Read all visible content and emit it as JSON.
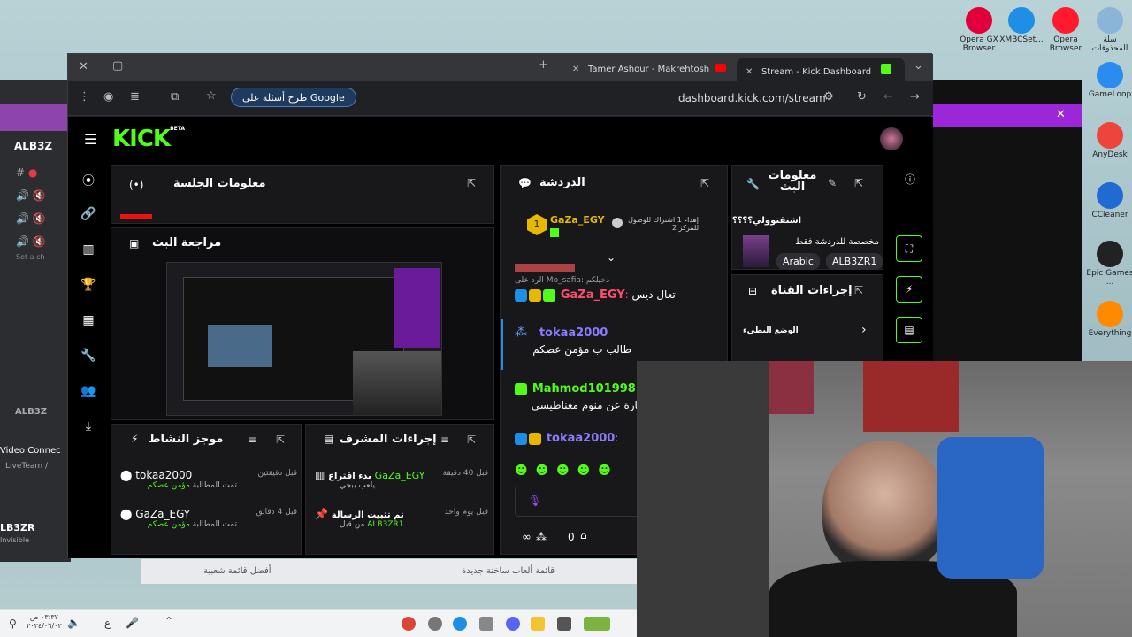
{
  "desktop": {
    "icons": [
      {
        "label": "Opera GX Browser",
        "color": "#e1003c"
      },
      {
        "label": "XMBCSet...",
        "color": "#1f8fe5"
      },
      {
        "label": "Opera Browser",
        "color": "#ff1b2d"
      },
      {
        "label": "سلة المحذوفات",
        "color": "#8ab4d8"
      },
      {
        "label": "GameLoop",
        "color": "#2a8cf0"
      },
      {
        "label": "AnyDesk",
        "color": "#ef443b"
      },
      {
        "label": "CCleaner",
        "color": "#1f6bd1"
      },
      {
        "label": "Epic Games ...",
        "color": "#222222"
      },
      {
        "label": "Everything",
        "color": "#ff8a00"
      }
    ]
  },
  "taskbar": {
    "clock_time": "٠٣:٣٧ ص",
    "clock_date": "٢٠٢٤/٠٦/٠٢",
    "lang": "ع"
  },
  "bottom_strip": {
    "left_label": "أفضل قائمة شعبية",
    "right_label": "قائمة ألعاب ساخنة جديدة"
  },
  "discord_left": {
    "server": "ALB3Z",
    "hint": "Set a ch",
    "user": "LB3ZR",
    "user_status": "Invisible",
    "connection": "Video Connec",
    "team": "LiveTeam /"
  },
  "browser": {
    "tabs": [
      {
        "label": "Tamer Ashour - Makrehtosh"
      },
      {
        "label": "Stream - Kick Dashboard"
      }
    ],
    "google_pill": "طرح أسئلة على Google",
    "url": "dashboard.kick.com/stream"
  },
  "kick": {
    "logo": "KICK",
    "logo_sup": "BETA",
    "session": {
      "title": "معلومات الجلسة"
    },
    "preview": {
      "title": "مراجعة البث"
    },
    "chat": {
      "title": "الدردشة",
      "pinned_user": "GaZa_EGY",
      "pinned_badge": "1",
      "pinned_gift": "إهداء 1 اشتراك للوصول للمركز 2",
      "reply_label": "الرد على Mo_safia: دخيلكم",
      "messages": [
        {
          "user": "GaZa_EGY",
          "text": "تعال ديس",
          "color": "#ff4d6d"
        },
        {
          "user": "tokaa2000",
          "text": "طالب ب مؤمن عصكم",
          "color": "#8b7bff"
        },
        {
          "user": "Mahmod101998",
          "text": "عبارة عن منوم مغناطيسي",
          "color": "#53fc18"
        },
        {
          "user": "tokaa2000",
          "text": "",
          "color": "#8b7bff"
        }
      ],
      "viewers": "∞",
      "count": "0"
    },
    "stream_info": {
      "title": "معلومات البث",
      "stream_title": "اشتقتوولي؟؟؟؟",
      "category": "مخصصة للدردشة فقط",
      "tags": [
        "Arabic",
        "ALB3ZR1"
      ]
    },
    "channel_actions": {
      "title": "إجراءات القناة",
      "item": "الوضع البطيء"
    },
    "activity": {
      "title": "موجز النشاط",
      "items": [
        {
          "user": "tokaa2000",
          "time": "قبل دقيقتين",
          "sub": "تمت المطالبة",
          "reward": "مؤمن عصكم"
        },
        {
          "user": "GaZa_EGY",
          "time": "قبل 4 دقائق",
          "sub": "تمت المطالبة",
          "reward": "مؤمن عصكم"
        }
      ]
    },
    "mod_actions": {
      "title": "إجراءات المشرف",
      "items": [
        {
          "head": "بدء اقتراع",
          "user": "GaZa_EGY",
          "detail": "يلعب ببجي",
          "time": "قبل 40 دقيقة"
        },
        {
          "head": "تم تثبيت الرسالة",
          "user": "ALB3ZR1",
          "detail": "من قبل",
          "time": "قبل يوم واحد"
        }
      ]
    }
  }
}
